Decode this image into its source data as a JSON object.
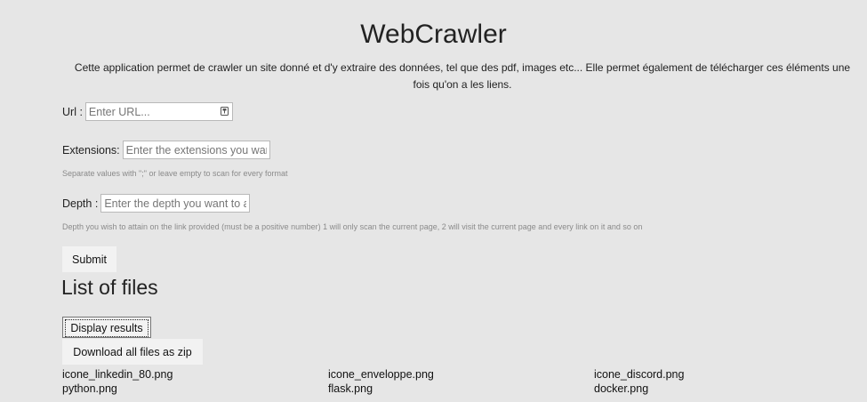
{
  "header": {
    "title": "WebCrawler",
    "description": "Cette application permet de crawler un site donné et d'y extraire des données, tel que des pdf, images etc... Elle permet également de télécharger ces éléments une fois qu'on a les liens."
  },
  "form": {
    "url": {
      "label": "Url :",
      "placeholder": "Enter URL...",
      "value": ""
    },
    "extensions": {
      "label": "Extensions:",
      "placeholder": "Enter the extensions you want to scan",
      "value": "",
      "help": "Separate values with \";\" or leave empty to scan for every format"
    },
    "depth": {
      "label": "Depth :",
      "placeholder": "Enter the depth you want to attain",
      "value": "",
      "help": "Depth you wish to attain on the link provided (must be a positive number) 1 will only scan the current page, 2 will visit the current page and every link on it and so on"
    },
    "submit_label": "Submit"
  },
  "files_section": {
    "title": "List of files",
    "display_results_label": "Display results",
    "download_zip_label": "Download all files as zip",
    "files": [
      "icone_linkedin_80.png",
      "icone_enveloppe.png",
      "icone_discord.png",
      "python.png",
      "flask.png",
      "docker.png"
    ]
  },
  "icons": {
    "url_field_icon": "password-key-icon"
  }
}
